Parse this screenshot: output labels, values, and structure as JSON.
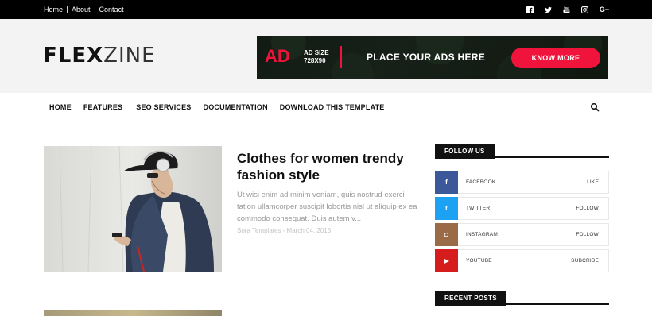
{
  "topbar": {
    "links": [
      "Home",
      "About",
      "Contact"
    ],
    "social_icons": [
      "facebook-icon",
      "twitter-icon",
      "youtube-icon",
      "instagram-icon",
      "google-plus-icon"
    ]
  },
  "header": {
    "logo_bold": "FLEX",
    "logo_thin": "ZINE",
    "ad": {
      "big": "AD",
      "size_line1": "AD SIZE",
      "size_line2": "728X90",
      "text": "PLACE YOUR ADS HERE",
      "button": "KNOW MORE"
    }
  },
  "nav": {
    "items": [
      "HOME",
      "FEATURES",
      "SEO SERVICES",
      "DOCUMENTATION",
      "DOWNLOAD THIS TEMPLATE"
    ],
    "search_icon": "search-icon"
  },
  "post": {
    "title": "Clothes for women trendy fashion style",
    "excerpt": "Ut wisi enim ad minim veniam, quis nostrud exerci tation ullamcorper suscipit lobortis nisl ut aliquip ex ea commodo consequat. Duis autem v...",
    "meta": "Sora Templates - March 04, 2015"
  },
  "sidebar": {
    "follow_title": "FOLLOW US",
    "social": [
      {
        "name": "FACEBOOK",
        "action": "LIKE",
        "color": "#3b5998",
        "icon": "facebook-icon",
        "glyph": "f"
      },
      {
        "name": "TWITTER",
        "action": "FOLLOW",
        "color": "#1da1f2",
        "icon": "twitter-icon",
        "glyph": "t"
      },
      {
        "name": "INSTAGRAM",
        "action": "FOLLOW",
        "color": "#9b6a47",
        "icon": "instagram-icon",
        "glyph": "◘"
      },
      {
        "name": "YOUTUBE",
        "action": "SUBCRIBE",
        "color": "#d61d1d",
        "icon": "youtube-icon",
        "glyph": "▶"
      }
    ],
    "recent_title": "RECENT POSTS"
  },
  "colors": {
    "accent": "#f0143c",
    "topbar_bg": "#000000",
    "header_bg": "#f3f3f3"
  }
}
